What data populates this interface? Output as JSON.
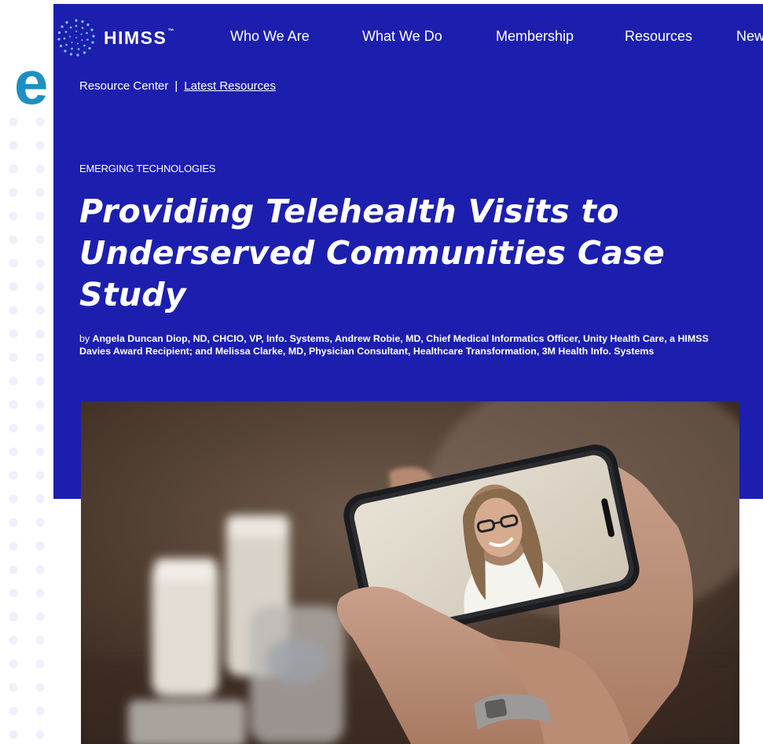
{
  "brand": {
    "name": "HIMSS",
    "trademark": "™"
  },
  "nav": {
    "items": [
      "Who We Are",
      "What We Do",
      "Membership",
      "Resources",
      "New"
    ]
  },
  "stray_letter": "e",
  "breadcrumb": {
    "root": "Resource Center",
    "separator": "|",
    "current": "Latest Resources"
  },
  "article": {
    "category": "EMERGING TECHNOLOGIES",
    "title": "Providing Telehealth Visits to Underserved Communities Case Study",
    "byline_prefix": "by ",
    "byline_authors": "Angela Duncan Diop, ND, CHCIO, VP, Info. Systems, Andrew Robie, MD, Chief Medical Informatics Officer, Unity Health Care, a HIMSS Davies Award Recipient; and Melissa Clarke, MD, Physician Consultant, Healthcare Transformation, 3M Health Info. Systems"
  },
  "colors": {
    "hero_bg": "#1c1fae",
    "stray_letter": "#1e8fc1",
    "text": "#ffffff"
  },
  "icons": {
    "logo": "himss-globe-icon"
  }
}
